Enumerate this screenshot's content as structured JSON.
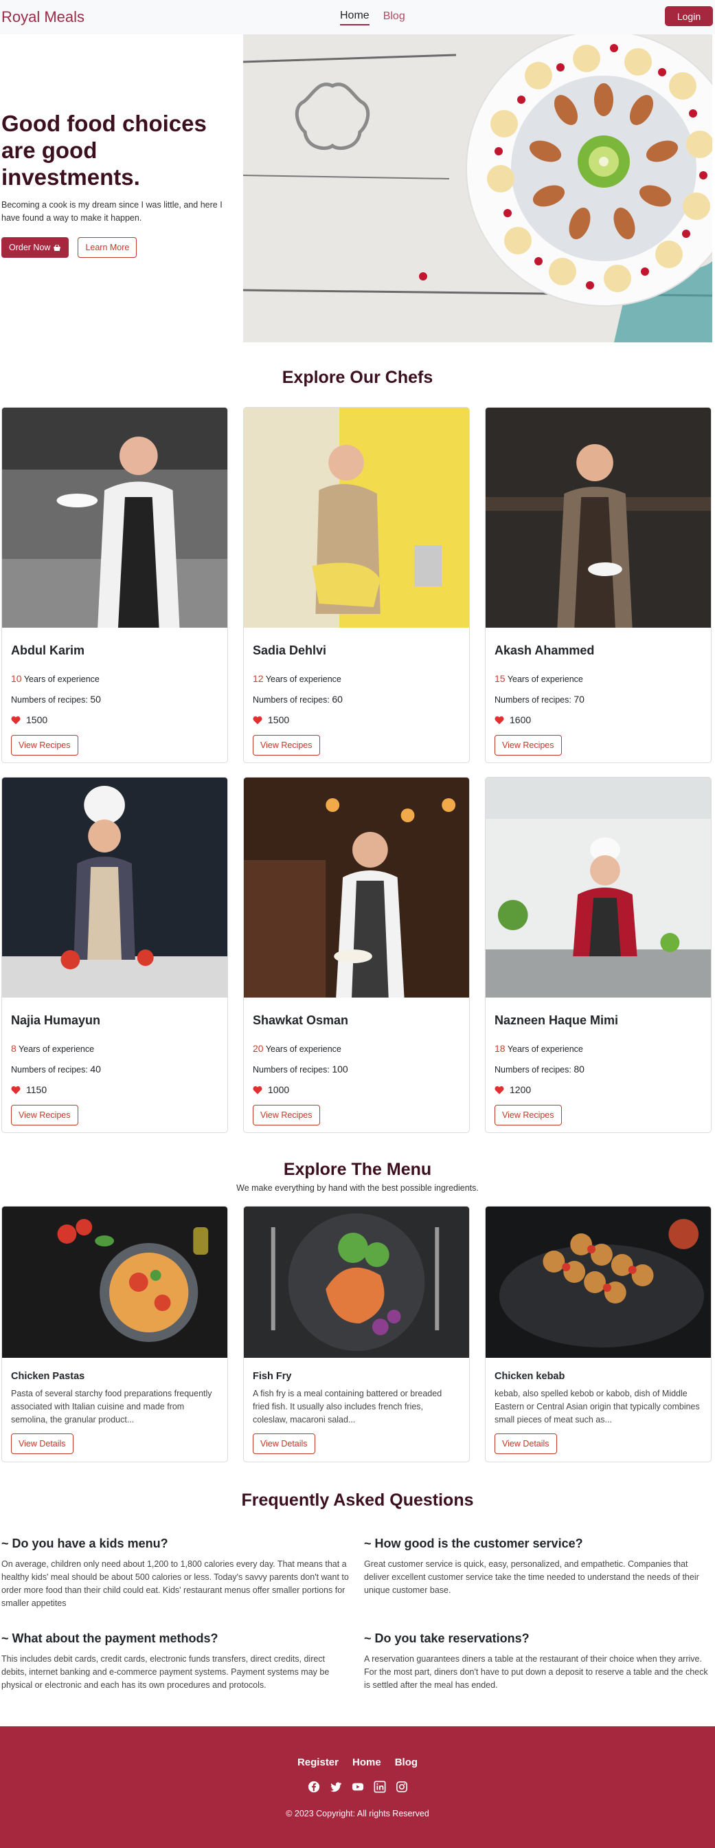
{
  "nav": {
    "brand": "Royal Meals",
    "links": [
      "Home",
      "Blog"
    ],
    "login": "Login"
  },
  "hero": {
    "title": "Good food choices are good investments.",
    "subtitle": "Becoming a cook is my dream since I was little, and here I have found a way to make it happen.",
    "order_btn": "Order Now",
    "learn_btn": "Learn More"
  },
  "chefs": {
    "title": "Explore Our Chefs",
    "exp_label": "Years of experience",
    "recipes_label": "Numbers of recipes:",
    "btn": "View Recipes",
    "items": [
      {
        "name": "Abdul Karim",
        "years": "10",
        "recipes": "50",
        "likes": "1500"
      },
      {
        "name": "Sadia Dehlvi",
        "years": "12",
        "recipes": "60",
        "likes": "1500"
      },
      {
        "name": "Akash Ahammed",
        "years": "15",
        "recipes": "70",
        "likes": "1600"
      },
      {
        "name": "Najia Humayun",
        "years": "8",
        "recipes": "40",
        "likes": "1150"
      },
      {
        "name": "Shawkat Osman",
        "years": "20",
        "recipes": "100",
        "likes": "1000"
      },
      {
        "name": "Nazneen Haque Mimi",
        "years": "18",
        "recipes": "80",
        "likes": "1200"
      }
    ]
  },
  "menu": {
    "title": "Explore The Menu",
    "subtitle": "We make everything by hand with the best possible ingredients.",
    "btn": "View Details",
    "items": [
      {
        "name": "Chicken Pastas",
        "desc": "Pasta of several starchy food preparations frequently associated with Italian cuisine and made from semolina, the granular product..."
      },
      {
        "name": "Fish Fry",
        "desc": "A fish fry is a meal containing battered or breaded fried fish. It usually also includes french fries, coleslaw, macaroni salad..."
      },
      {
        "name": "Chicken kebab",
        "desc": "kebab, also spelled kebob or kabob, dish of Middle Eastern or Central Asian origin that typically combines small pieces of meat such as..."
      }
    ]
  },
  "faq": {
    "title": "Frequently Asked Questions",
    "items": [
      {
        "q": "~ Do you have a kids menu?",
        "a": "On average, children only need about 1,200 to 1,800 calories every day. That means that a healthy kids' meal should be about 500 calories or less. Today's savvy parents don't want to order more food than their child could eat. Kids' restaurant menus offer smaller portions for smaller appetites"
      },
      {
        "q": "~ How good is the customer service?",
        "a": "Great customer service is quick, easy, personalized, and empathetic. Companies that deliver excellent customer service take the time needed to understand the needs of their unique customer base."
      },
      {
        "q": "~ What about the payment methods?",
        "a": "This includes debit cards, credit cards, electronic funds transfers, direct credits, direct debits, internet banking and e-commerce payment systems. Payment systems may be physical or electronic and each has its own procedures and protocols."
      },
      {
        "q": "~ Do you take reservations?",
        "a": "A reservation guarantees diners a table at the restaurant of their choice when they arrive. For the most part, diners don't have to put down a deposit to reserve a table and the check is settled after the meal has ended."
      }
    ]
  },
  "footer": {
    "links": [
      "Register",
      "Home",
      "Blog"
    ],
    "icons": [
      "facebook-icon",
      "twitter-icon",
      "youtube-icon",
      "linkedin-icon",
      "instagram-icon"
    ],
    "copyright": "© 2023 Copyright: All rights Reserved"
  },
  "colors": {
    "brand": "#9c2b48",
    "primary": "#a6283f",
    "accent_red": "#d63a2f",
    "heading": "#3c0f1e"
  }
}
